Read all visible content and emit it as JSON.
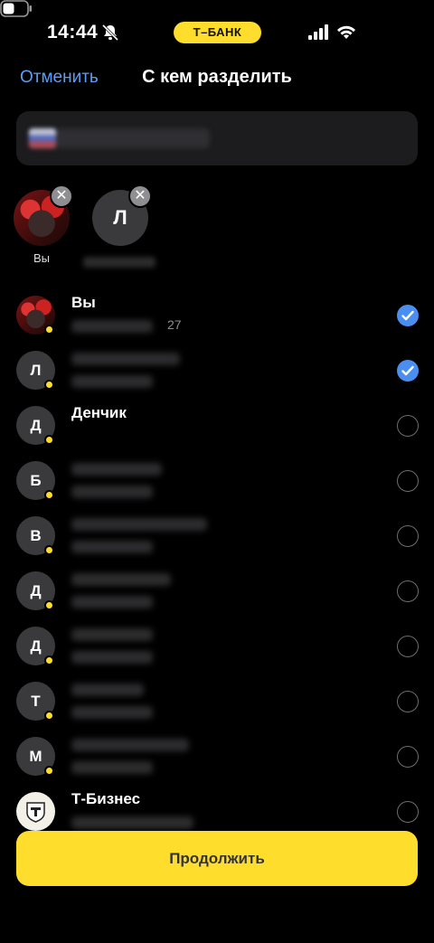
{
  "status_bar": {
    "time": "14:44",
    "bank_pill": "Т–БАНК"
  },
  "header": {
    "cancel_label": "Отменить",
    "title": "С кем разделить"
  },
  "chips": [
    {
      "avatar": "photo",
      "label": "Вы"
    },
    {
      "avatar": "Л",
      "label": ""
    }
  ],
  "contacts": [
    {
      "initial": "",
      "avatar": "photo",
      "name": "Вы",
      "sub": "27",
      "selected": true
    },
    {
      "initial": "Л",
      "name": "",
      "selected": true
    },
    {
      "initial": "Д",
      "name": "Денчик",
      "selected": false
    },
    {
      "initial": "Б",
      "name": "",
      "selected": false
    },
    {
      "initial": "В",
      "name": "",
      "selected": false
    },
    {
      "initial": "Д",
      "name": "",
      "selected": false
    },
    {
      "initial": "Д",
      "name": "",
      "selected": false
    },
    {
      "initial": "Т",
      "name": "",
      "selected": false
    },
    {
      "initial": "М",
      "name": "",
      "selected": false
    },
    {
      "initial": "",
      "avatar": "t-logo",
      "name": "Т-Бизнес",
      "selected": false
    }
  ],
  "continue_label": "Продолжить",
  "colors": {
    "accent_yellow": "#ffdd2d",
    "link_blue": "#5b9ef7",
    "check_blue": "#4a8ef0",
    "background": "#000000"
  }
}
